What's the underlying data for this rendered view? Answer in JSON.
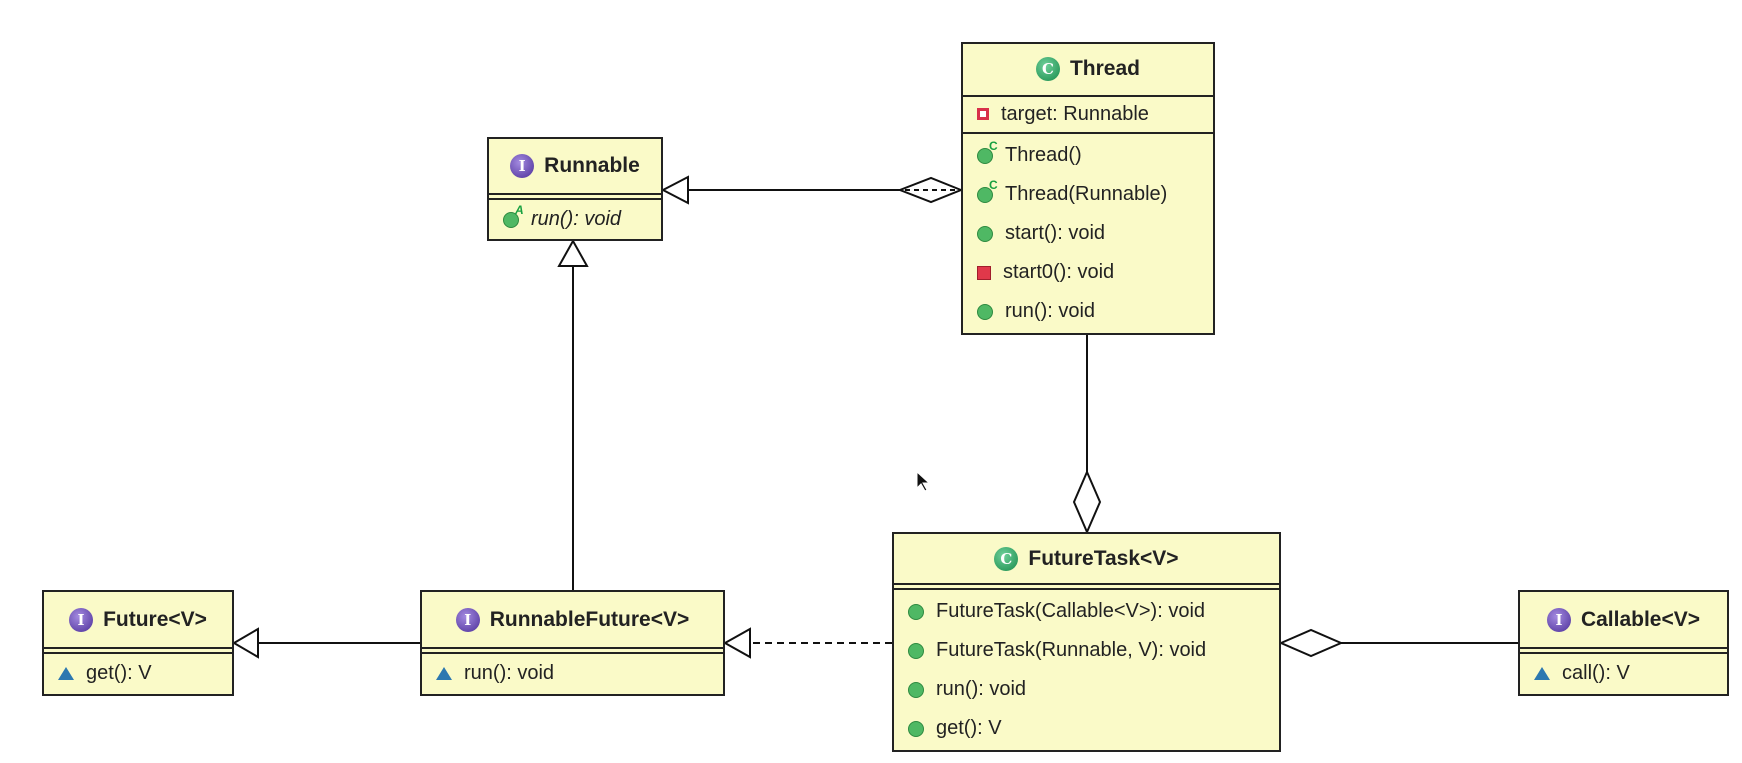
{
  "classes": {
    "thread": {
      "name": "Thread",
      "kind": "class",
      "attributes": [
        {
          "visibility": "private",
          "text": "target: Runnable"
        }
      ],
      "methods": [
        {
          "visibility": "public-constructor",
          "text": "Thread()"
        },
        {
          "visibility": "public-constructor",
          "text": "Thread(Runnable)"
        },
        {
          "visibility": "public",
          "text": "start(): void"
        },
        {
          "visibility": "private",
          "text": "start0(): void"
        },
        {
          "visibility": "public",
          "text": "run(): void"
        }
      ]
    },
    "runnable": {
      "name": "Runnable",
      "kind": "interface",
      "methods": [
        {
          "visibility": "public-abstract",
          "text": "run(): void"
        }
      ]
    },
    "future": {
      "name": "Future<V>",
      "kind": "interface",
      "methods": [
        {
          "visibility": "package",
          "text": "get(): V"
        }
      ]
    },
    "runnableFuture": {
      "name": "RunnableFuture<V>",
      "kind": "interface",
      "methods": [
        {
          "visibility": "package",
          "text": "run(): void"
        }
      ]
    },
    "futureTask": {
      "name": "FutureTask<V>",
      "kind": "class",
      "methods": [
        {
          "visibility": "public",
          "text": "FutureTask(Callable<V>): void"
        },
        {
          "visibility": "public",
          "text": "FutureTask(Runnable, V): void"
        },
        {
          "visibility": "public",
          "text": "run(): void"
        },
        {
          "visibility": "public",
          "text": "get(): V"
        }
      ]
    },
    "callable": {
      "name": "Callable<V>",
      "kind": "interface",
      "methods": [
        {
          "visibility": "package",
          "text": "call(): V"
        }
      ]
    }
  },
  "kind_badges": {
    "class": "C",
    "interface": "I",
    "constructor": "C",
    "abstract": "A"
  },
  "relations": [
    {
      "from": "Thread",
      "to": "Runnable",
      "type": "aggregation-generalization"
    },
    {
      "from": "Thread",
      "to": "FutureTask<V>",
      "type": "aggregation"
    },
    {
      "from": "RunnableFuture<V>",
      "to": "Runnable",
      "type": "generalization"
    },
    {
      "from": "RunnableFuture<V>",
      "to": "Future<V>",
      "type": "generalization"
    },
    {
      "from": "FutureTask<V>",
      "to": "RunnableFuture<V>",
      "type": "realization"
    },
    {
      "from": "Callable<V>",
      "to": "FutureTask<V>",
      "type": "aggregation"
    }
  ],
  "colors": {
    "box_fill": "#fafac8",
    "class_icon": "#178a4a",
    "interface_icon": "#4b2e98",
    "public": "#4fb864",
    "private": "#e0384a",
    "package": "#2c78b0"
  }
}
